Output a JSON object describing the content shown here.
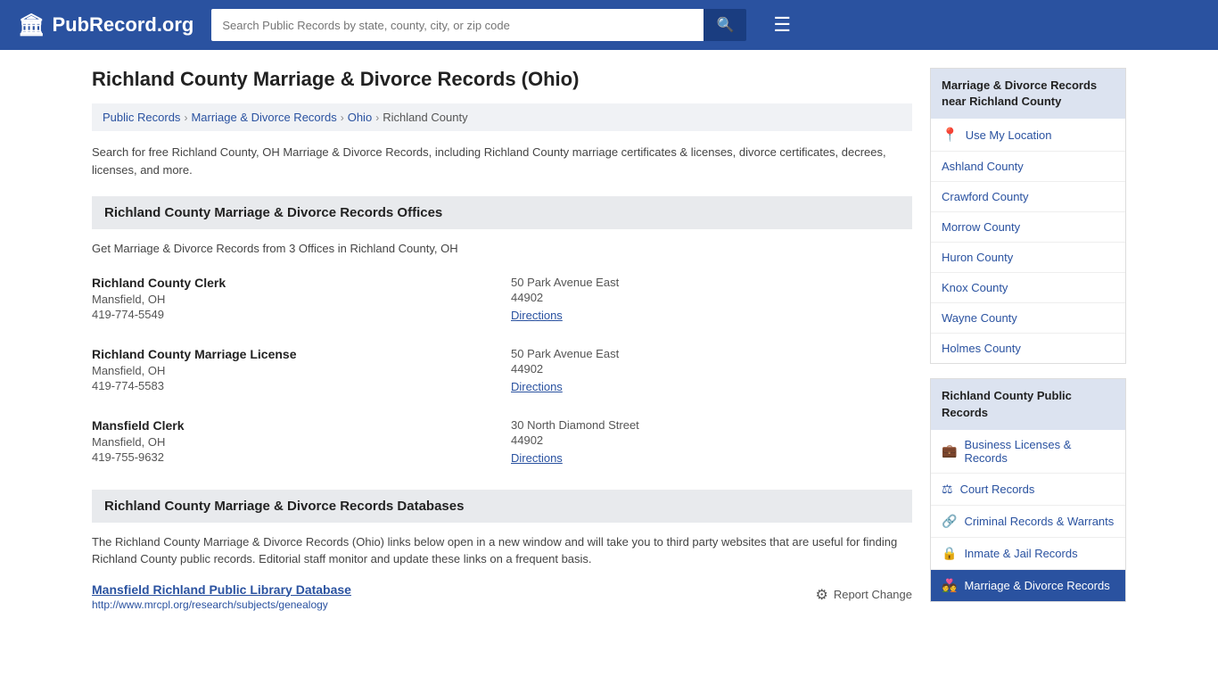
{
  "header": {
    "logo_text": "PubRecord.org",
    "logo_icon": "🏛",
    "search_placeholder": "Search Public Records by state, county, city, or zip code",
    "search_icon": "🔍",
    "menu_icon": "☰"
  },
  "page": {
    "title": "Richland County Marriage & Divorce Records (Ohio)",
    "breadcrumbs": [
      {
        "label": "Public Records",
        "href": "#"
      },
      {
        "label": "Marriage & Divorce Records",
        "href": "#"
      },
      {
        "label": "Ohio",
        "href": "#"
      },
      {
        "label": "Richland County",
        "href": "#"
      }
    ],
    "description": "Search for free Richland County, OH Marriage & Divorce Records, including Richland County marriage certificates & licenses, divorce certificates, decrees, licenses, and more."
  },
  "offices_section": {
    "heading": "Richland County Marriage & Divorce Records Offices",
    "subtext": "Get Marriage & Divorce Records from 3 Offices in Richland County, OH",
    "offices": [
      {
        "name": "Richland County Clerk",
        "city": "Mansfield, OH",
        "phone": "419-774-5549",
        "address": "50 Park Avenue East",
        "zip": "44902",
        "directions": "Directions"
      },
      {
        "name": "Richland County Marriage License",
        "city": "Mansfield, OH",
        "phone": "419-774-5583",
        "address": "50 Park Avenue East",
        "zip": "44902",
        "directions": "Directions"
      },
      {
        "name": "Mansfield Clerk",
        "city": "Mansfield, OH",
        "phone": "419-755-9632",
        "address": "30 North Diamond Street",
        "zip": "44902",
        "directions": "Directions"
      }
    ]
  },
  "databases_section": {
    "heading": "Richland County Marriage & Divorce Records Databases",
    "description": "The Richland County Marriage & Divorce Records (Ohio) links below open in a new window and will take you to third party websites that are useful for finding Richland County public records. Editorial staff monitor and update these links on a frequent basis.",
    "entries": [
      {
        "name": "Mansfield Richland Public Library Database",
        "url": "http://www.mrcpl.org/research/subjects/genealogy"
      }
    ],
    "report_change": "Report Change",
    "report_icon": "⚙"
  },
  "sidebar": {
    "nearby_header": "Marriage & Divorce Records near Richland County",
    "location_label": "Use My Location",
    "nearby_counties": [
      "Ashland County",
      "Crawford County",
      "Morrow County",
      "Huron County",
      "Knox County",
      "Wayne County",
      "Holmes County"
    ],
    "public_records_header": "Richland County Public Records",
    "public_records": [
      {
        "icon": "💼",
        "label": "Business Licenses & Records"
      },
      {
        "icon": "⚖",
        "label": "Court Records"
      },
      {
        "icon": "🔗",
        "label": "Criminal Records & Warrants"
      },
      {
        "icon": "🔒",
        "label": "Inmate & Jail Records"
      },
      {
        "icon": "💑",
        "label": "Marriage & Divorce Records",
        "active": true
      }
    ]
  }
}
